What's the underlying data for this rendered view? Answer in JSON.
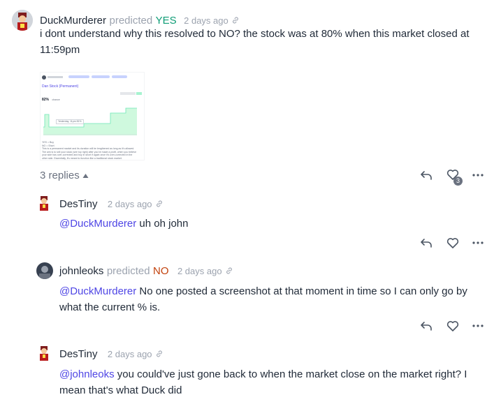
{
  "top_comment": {
    "username": "DuckMurderer",
    "predicted_word": "predicted",
    "prediction": "YES",
    "time": "2 days ago",
    "text_line1": "i dont understand why this resolved to NO? the stock was at 80% when this market closed at",
    "text_line2": "11:59pm",
    "attachment": {
      "market_title": "Dan Stock (Permanent)",
      "percent": "82%",
      "percent_label": "chance",
      "tooltip": "Yesterday, 11pm 81%",
      "description_lines": [
        "YES = Buy",
        "NO = Short",
        "This is a permanent market and its duration will be lengthened as long as it's allowed.",
        "The aim is to sell your stock (see top right) after you've made a profit, when you believe",
        "your side has over-corrected and buy in short if again once it's over-corrected in the",
        "other side. Essentially, it's meant to function like a traditional stock market."
      ]
    },
    "replies_label": "3 replies",
    "like_count": "3"
  },
  "replies": [
    {
      "username": "DesTiny",
      "time": "2 days ago",
      "mention": "@DuckMurderer",
      "text_line1": " uh oh john",
      "text_line2": ""
    },
    {
      "username": "johnleoks",
      "predicted_word": "predicted",
      "prediction": "NO",
      "time": "2 days ago",
      "mention": "@DuckMurderer",
      "text_line1": " No one posted a screenshot at that moment in time so I can only go by",
      "text_line2": "what the current % is."
    },
    {
      "username": "DesTiny",
      "time": "2 days ago",
      "mention": "@johnleoks",
      "text_line1": " you could've just gone back to when the market close on the market right? I",
      "text_line2": "mean that's what Duck did"
    }
  ],
  "icons": {
    "reply": "reply-arrow-icon",
    "like": "heart-icon",
    "more": "more-dots-icon",
    "link": "link-icon",
    "caret": "caret-up-icon"
  },
  "colors": {
    "yes": "#0f9d76",
    "no": "#c2410c",
    "mention": "#4f46e5",
    "muted": "#9ca3af"
  }
}
